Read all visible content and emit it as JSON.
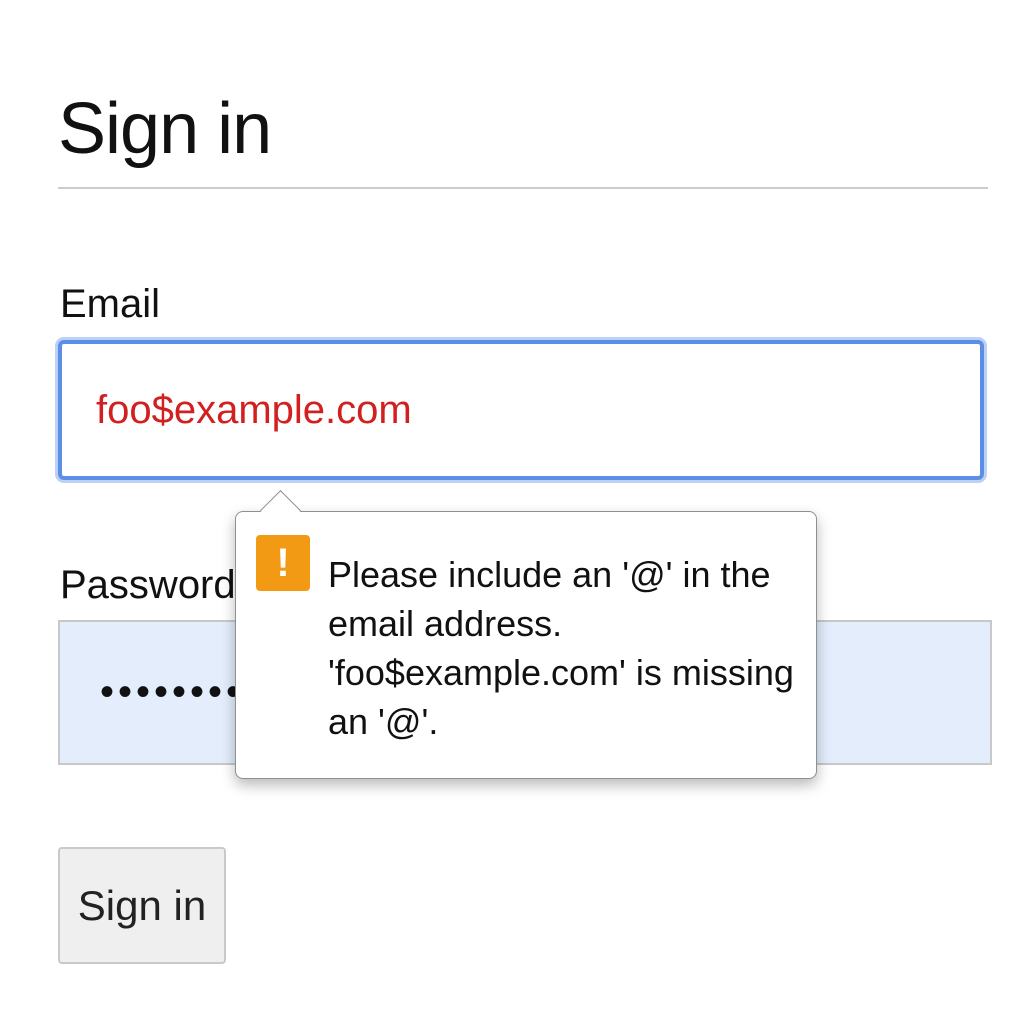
{
  "page_title": "Sign in",
  "form": {
    "email_label": "Email",
    "email_value": "foo$example.com",
    "password_label": "Password",
    "password_value": "••••••••••",
    "submit_label": "Sign in"
  },
  "validation_tooltip": {
    "icon": "warning-icon",
    "icon_glyph": "!",
    "message": "Please include an '@' in the\nemail address.\n'foo$example.com' is missing\nan '@'."
  },
  "colors": {
    "focus_ring": "#5b8fe6",
    "error_text": "#d21f1f",
    "warning": "#f39a14",
    "autofill_background": "#e3edfc"
  }
}
